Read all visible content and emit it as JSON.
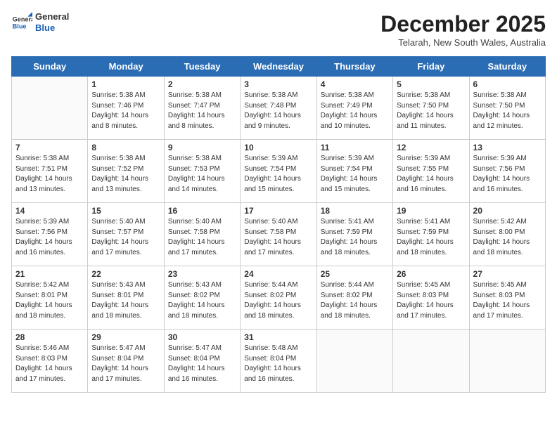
{
  "header": {
    "logo_general": "General",
    "logo_blue": "Blue",
    "month_title": "December 2025",
    "location": "Telarah, New South Wales, Australia"
  },
  "days_of_week": [
    "Sunday",
    "Monday",
    "Tuesday",
    "Wednesday",
    "Thursday",
    "Friday",
    "Saturday"
  ],
  "weeks": [
    [
      {
        "day": "",
        "content": ""
      },
      {
        "day": "1",
        "content": "Sunrise: 5:38 AM\nSunset: 7:46 PM\nDaylight: 14 hours\nand 8 minutes."
      },
      {
        "day": "2",
        "content": "Sunrise: 5:38 AM\nSunset: 7:47 PM\nDaylight: 14 hours\nand 8 minutes."
      },
      {
        "day": "3",
        "content": "Sunrise: 5:38 AM\nSunset: 7:48 PM\nDaylight: 14 hours\nand 9 minutes."
      },
      {
        "day": "4",
        "content": "Sunrise: 5:38 AM\nSunset: 7:49 PM\nDaylight: 14 hours\nand 10 minutes."
      },
      {
        "day": "5",
        "content": "Sunrise: 5:38 AM\nSunset: 7:50 PM\nDaylight: 14 hours\nand 11 minutes."
      },
      {
        "day": "6",
        "content": "Sunrise: 5:38 AM\nSunset: 7:50 PM\nDaylight: 14 hours\nand 12 minutes."
      }
    ],
    [
      {
        "day": "7",
        "content": "Sunrise: 5:38 AM\nSunset: 7:51 PM\nDaylight: 14 hours\nand 13 minutes."
      },
      {
        "day": "8",
        "content": "Sunrise: 5:38 AM\nSunset: 7:52 PM\nDaylight: 14 hours\nand 13 minutes."
      },
      {
        "day": "9",
        "content": "Sunrise: 5:38 AM\nSunset: 7:53 PM\nDaylight: 14 hours\nand 14 minutes."
      },
      {
        "day": "10",
        "content": "Sunrise: 5:39 AM\nSunset: 7:54 PM\nDaylight: 14 hours\nand 15 minutes."
      },
      {
        "day": "11",
        "content": "Sunrise: 5:39 AM\nSunset: 7:54 PM\nDaylight: 14 hours\nand 15 minutes."
      },
      {
        "day": "12",
        "content": "Sunrise: 5:39 AM\nSunset: 7:55 PM\nDaylight: 14 hours\nand 16 minutes."
      },
      {
        "day": "13",
        "content": "Sunrise: 5:39 AM\nSunset: 7:56 PM\nDaylight: 14 hours\nand 16 minutes."
      }
    ],
    [
      {
        "day": "14",
        "content": "Sunrise: 5:39 AM\nSunset: 7:56 PM\nDaylight: 14 hours\nand 16 minutes."
      },
      {
        "day": "15",
        "content": "Sunrise: 5:40 AM\nSunset: 7:57 PM\nDaylight: 14 hours\nand 17 minutes."
      },
      {
        "day": "16",
        "content": "Sunrise: 5:40 AM\nSunset: 7:58 PM\nDaylight: 14 hours\nand 17 minutes."
      },
      {
        "day": "17",
        "content": "Sunrise: 5:40 AM\nSunset: 7:58 PM\nDaylight: 14 hours\nand 17 minutes."
      },
      {
        "day": "18",
        "content": "Sunrise: 5:41 AM\nSunset: 7:59 PM\nDaylight: 14 hours\nand 18 minutes."
      },
      {
        "day": "19",
        "content": "Sunrise: 5:41 AM\nSunset: 7:59 PM\nDaylight: 14 hours\nand 18 minutes."
      },
      {
        "day": "20",
        "content": "Sunrise: 5:42 AM\nSunset: 8:00 PM\nDaylight: 14 hours\nand 18 minutes."
      }
    ],
    [
      {
        "day": "21",
        "content": "Sunrise: 5:42 AM\nSunset: 8:01 PM\nDaylight: 14 hours\nand 18 minutes."
      },
      {
        "day": "22",
        "content": "Sunrise: 5:43 AM\nSunset: 8:01 PM\nDaylight: 14 hours\nand 18 minutes."
      },
      {
        "day": "23",
        "content": "Sunrise: 5:43 AM\nSunset: 8:02 PM\nDaylight: 14 hours\nand 18 minutes."
      },
      {
        "day": "24",
        "content": "Sunrise: 5:44 AM\nSunset: 8:02 PM\nDaylight: 14 hours\nand 18 minutes."
      },
      {
        "day": "25",
        "content": "Sunrise: 5:44 AM\nSunset: 8:02 PM\nDaylight: 14 hours\nand 18 minutes."
      },
      {
        "day": "26",
        "content": "Sunrise: 5:45 AM\nSunset: 8:03 PM\nDaylight: 14 hours\nand 17 minutes."
      },
      {
        "day": "27",
        "content": "Sunrise: 5:45 AM\nSunset: 8:03 PM\nDaylight: 14 hours\nand 17 minutes."
      }
    ],
    [
      {
        "day": "28",
        "content": "Sunrise: 5:46 AM\nSunset: 8:03 PM\nDaylight: 14 hours\nand 17 minutes."
      },
      {
        "day": "29",
        "content": "Sunrise: 5:47 AM\nSunset: 8:04 PM\nDaylight: 14 hours\nand 17 minutes."
      },
      {
        "day": "30",
        "content": "Sunrise: 5:47 AM\nSunset: 8:04 PM\nDaylight: 14 hours\nand 16 minutes."
      },
      {
        "day": "31",
        "content": "Sunrise: 5:48 AM\nSunset: 8:04 PM\nDaylight: 14 hours\nand 16 minutes."
      },
      {
        "day": "",
        "content": ""
      },
      {
        "day": "",
        "content": ""
      },
      {
        "day": "",
        "content": ""
      }
    ]
  ]
}
